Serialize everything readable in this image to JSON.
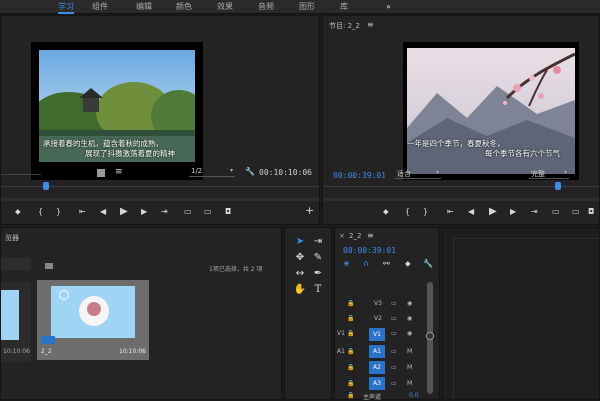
{
  "menu": [
    "学习",
    "组件",
    "编辑",
    "颜色",
    "效果",
    "音频",
    "图形",
    "库"
  ],
  "menu_more": "»",
  "source": {
    "subtitle_line1": "承接着春的生机，蕴含着秋的成熟，",
    "subtitle_line2": "展现了抖擞激荡着夏的精神",
    "zoom": "1/2",
    "timecode": "00:10:10:06"
  },
  "program": {
    "title": "节目: 2_2",
    "subtitle_line1": "一年是四个季节，春夏秋冬，",
    "subtitle_line2": "每个季节各有六个节气",
    "timecode": "00:00:39:01",
    "fit": "适合",
    "quality": "完整"
  },
  "project": {
    "title": "览器",
    "selection_info": "1项已选择，共 2 项",
    "clip1_duration": "10:10:06",
    "clip2_name": "2_2",
    "clip2_duration": "10:10:06"
  },
  "timeline": {
    "title": "2_2",
    "timecode": "00:00:39:01",
    "video_tracks": [
      "V3",
      "V2",
      "V1"
    ],
    "audio_tracks": [
      "A1",
      "A2",
      "A3"
    ],
    "master": "主声道",
    "master_value": "0.0"
  },
  "colors": {
    "accent": "#3f8be8",
    "track_blue": "#2b73c8",
    "bg": "#1b1b1b",
    "panel": "#232323"
  }
}
